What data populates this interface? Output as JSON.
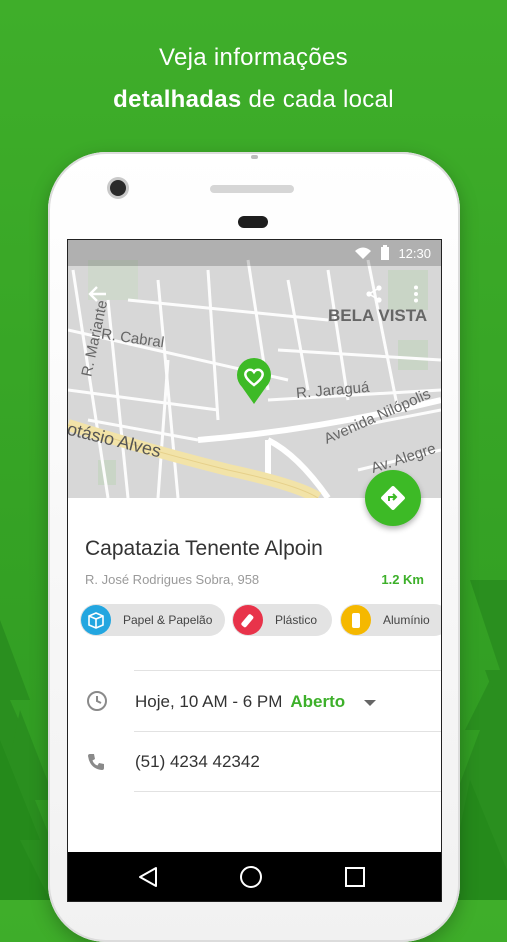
{
  "promo": {
    "line1": "Veja informações",
    "line2_bold": "detalhadas",
    "line2_rest": " de cada local"
  },
  "status_bar": {
    "time": "12:30"
  },
  "map": {
    "streets": [
      "R. Mariante",
      "R. Cabral",
      "BELA VISTA",
      "R. Jaraguá",
      "Avenida Nilópolis",
      "otásio Alves",
      "Av. Alegre"
    ]
  },
  "place": {
    "name": "Capatazia Tenente Alpoin",
    "address": "R. José Rodrigues Sobra, 958",
    "distance": "1.2 Km"
  },
  "materials": [
    {
      "label": "Papel & Papelão",
      "color": "#23a6e0",
      "icon": "box-icon"
    },
    {
      "label": "Plástico",
      "color": "#e8334a",
      "icon": "bottle-icon"
    },
    {
      "label": "Alumínio",
      "color": "#f5b800",
      "icon": "can-icon"
    }
  ],
  "hours": {
    "text": "Hoje, 10 AM - 6 PM",
    "status": "Aberto"
  },
  "phone": {
    "number": "(51) 4234 42342"
  },
  "colors": {
    "accent": "#3dba26",
    "background": "#38a626"
  }
}
